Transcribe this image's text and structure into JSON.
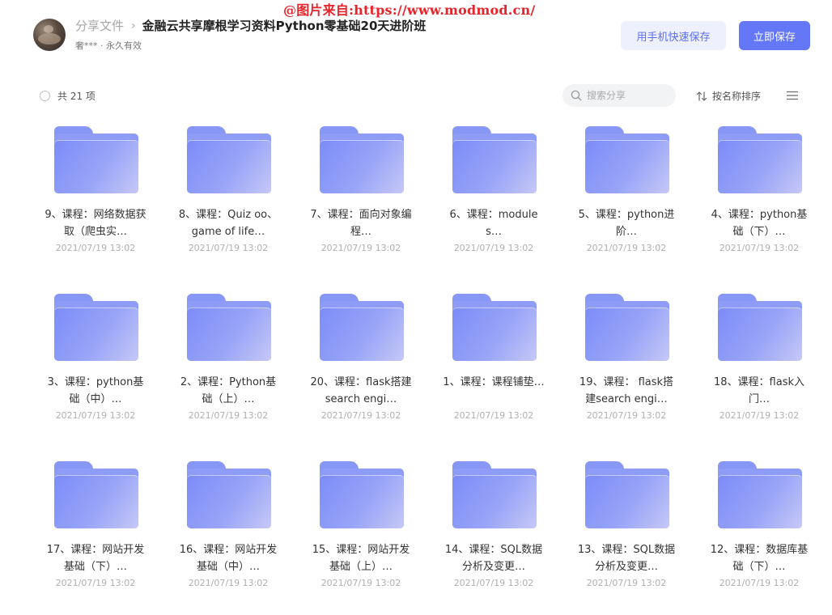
{
  "watermark": "@图片来自:https://www.modmod.cn/",
  "header": {
    "breadcrumb_parent": "分享文件",
    "breadcrumb_separator": "›",
    "title": "金融云共享摩根学习资料Python零基础20天进阶班",
    "sharer_info": "奢*** · 永久有效",
    "mobile_save_label": "用手机快速保存",
    "save_label": "立即保存"
  },
  "toolbar": {
    "item_count": "共 21 项",
    "search_placeholder": "搜索分享",
    "sort_label": "按名称排序",
    "icons": {
      "search": "search-icon",
      "sort": "sort-icon",
      "view": "list-view-icon"
    }
  },
  "colors": {
    "accent": "#6477f7",
    "accent_light": "#eef0fd",
    "folder": "#8e9cf6",
    "watermark": "#e8242b"
  },
  "files": [
    {
      "name": "9、课程：网络数据获取（爬虫实…",
      "date": "2021/07/19 13:02"
    },
    {
      "name": "8、课程：Quiz oo、game of life…",
      "date": "2021/07/19 13:02"
    },
    {
      "name": "7、课程：面向对象编程…",
      "date": "2021/07/19 13:02"
    },
    {
      "name": "6、课程：modules…",
      "date": "2021/07/19 13:02"
    },
    {
      "name": "5、课程：python进阶…",
      "date": "2021/07/19 13:02"
    },
    {
      "name": "4、课程：python基础（下）…",
      "date": "2021/07/19 13:02"
    },
    {
      "name": "3、课程：python基础（中）…",
      "date": "2021/07/19 13:02"
    },
    {
      "name": "2、课程：Python基础（上）…",
      "date": "2021/07/19 13:02"
    },
    {
      "name": "20、课程：flask搭建search engi…",
      "date": "2021/07/19 13:02"
    },
    {
      "name": "1、课程：课程铺垫…",
      "date": "2021/07/19 13:02"
    },
    {
      "name": "19、课程： flask搭建search engi…",
      "date": "2021/07/19 13:02"
    },
    {
      "name": "18、课程：flask入门…",
      "date": "2021/07/19 13:02"
    },
    {
      "name": "17、课程：网站开发基础（下）…",
      "date": "2021/07/19 13:02"
    },
    {
      "name": "16、课程：网站开发基础（中）…",
      "date": "2021/07/19 13:02"
    },
    {
      "name": "15、课程：网站开发基础（上）…",
      "date": "2021/07/19 13:02"
    },
    {
      "name": "14、课程：SQL数据分析及变更…",
      "date": "2021/07/19 13:02"
    },
    {
      "name": "13、课程：SQL数据分析及变更…",
      "date": "2021/07/19 13:02"
    },
    {
      "name": "12、课程：数据库基础（下）…",
      "date": "2021/07/19 13:02"
    }
  ]
}
